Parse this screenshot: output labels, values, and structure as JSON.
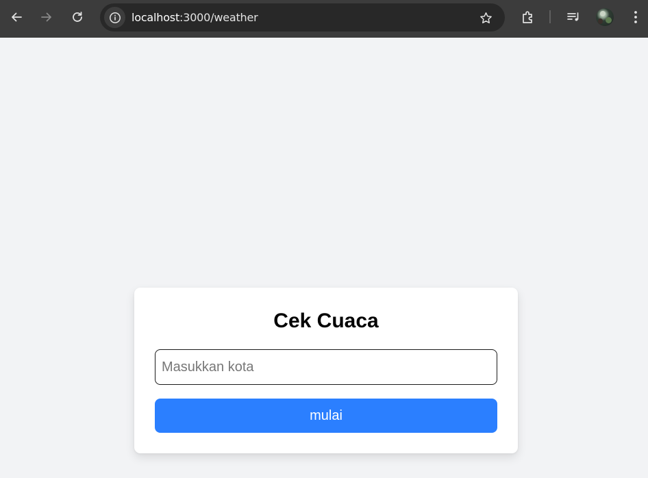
{
  "browser": {
    "url_host": "localhost",
    "url_path": ":3000/weather",
    "icons": {
      "back": "arrow-left-icon",
      "forward": "arrow-right-icon",
      "reload": "reload-icon",
      "site_info": "info-icon",
      "bookmark": "star-icon",
      "extensions": "puzzle-icon",
      "media": "media-queue-icon",
      "profile": "avatar",
      "menu": "kebab-menu-icon"
    }
  },
  "page": {
    "title": "Cek Cuaca",
    "city_input": {
      "value": "",
      "placeholder": "Masukkan kota"
    },
    "submit_label": "mulai"
  },
  "colors": {
    "toolbar": "#3c3c3c",
    "omnibox": "#282828",
    "page_background": "#f2f3f5",
    "card": "#ffffff",
    "button": "#2b7fff",
    "button_text": "#ffffff"
  }
}
